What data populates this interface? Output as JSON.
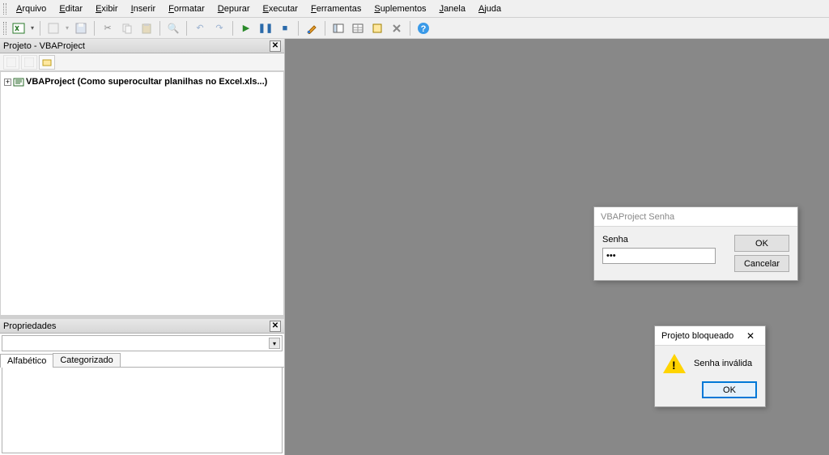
{
  "menu": {
    "items": [
      {
        "label": "Arquivo",
        "u": "A"
      },
      {
        "label": "Editar",
        "u": "E"
      },
      {
        "label": "Exibir",
        "u": "E"
      },
      {
        "label": "Inserir",
        "u": "I"
      },
      {
        "label": "Formatar",
        "u": "F"
      },
      {
        "label": "Depurar",
        "u": "D"
      },
      {
        "label": "Executar",
        "u": "E"
      },
      {
        "label": "Ferramentas",
        "u": "F"
      },
      {
        "label": "Suplementos",
        "u": "S"
      },
      {
        "label": "Janela",
        "u": "J"
      },
      {
        "label": "Ajuda",
        "u": "A"
      }
    ]
  },
  "project_pane": {
    "title": "Projeto - VBAProject",
    "tree_item": "VBAProject (Como superocultar planilhas no Excel.xls...)"
  },
  "properties_pane": {
    "title": "Propriedades",
    "tabs": {
      "alpha": "Alfabético",
      "cat": "Categorizado"
    }
  },
  "password_dialog": {
    "title": "VBAProject Senha",
    "label": "Senha",
    "value": "•••",
    "ok": "OK",
    "cancel": "Cancelar"
  },
  "locked_dialog": {
    "title": "Projeto bloqueado",
    "message": "Senha inválida",
    "ok": "OK"
  }
}
